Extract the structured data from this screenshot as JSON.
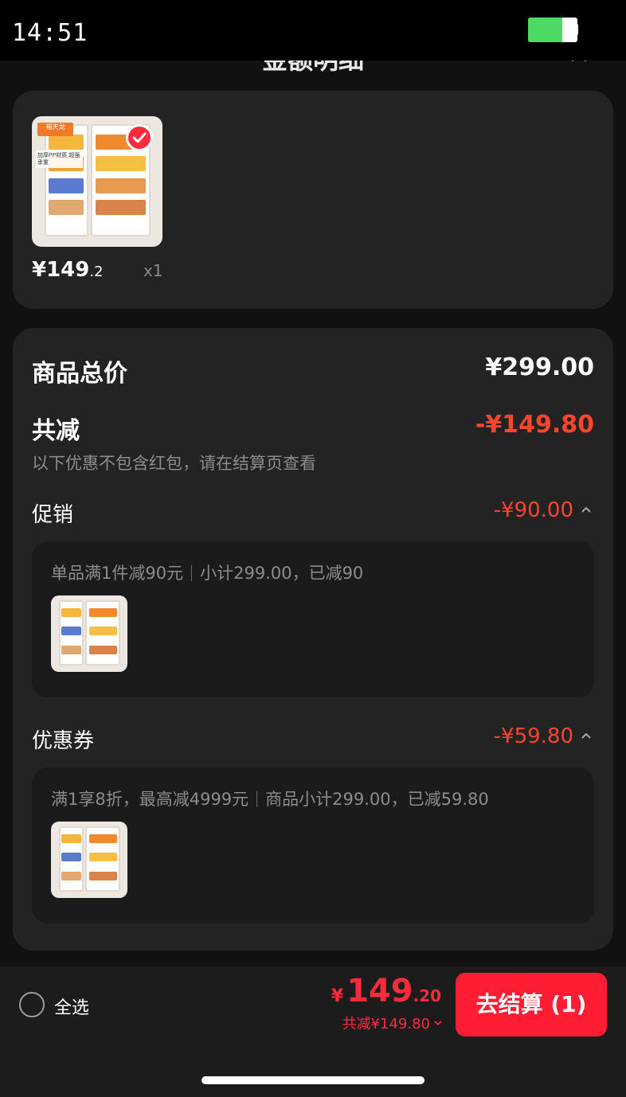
{
  "status_bar": {
    "time": "14:51",
    "battery_level": 0.7
  },
  "sheet": {
    "title": "金额明细",
    "close_icon": "close-icon"
  },
  "product": {
    "price_main": "¥149",
    "price_cents": ".2",
    "quantity": "x1",
    "selected": true,
    "thumbnail_tag": "福天龙",
    "thumbnail_caption": "加厚PP材质 超强承重"
  },
  "summary": {
    "total_label": "商品总价",
    "total_value": "¥299.00",
    "reduce_label": "共减",
    "reduce_value": "-¥149.80",
    "reduce_note": "以下优惠不包含红包，请在结算页查看",
    "promotion": {
      "label": "促销",
      "value": "-¥90.00",
      "desc_left": "单品满1件减90元",
      "desc_right": "小计299.00，已减90"
    },
    "coupon": {
      "label": "优惠券",
      "value": "-¥59.80",
      "desc_left": "满1享8折，最高减4999元",
      "desc_right": "商品小计299.00，已减59.80"
    }
  },
  "bottom_bar": {
    "select_all_label": "全选",
    "price_currency": "¥",
    "price_int": "149",
    "price_dec": ".20",
    "reduce_text": "共减¥149.80",
    "checkout_label": "去结算 (1)"
  },
  "colors": {
    "accent_red": "#ff2a3c",
    "discount_red": "#ff4530",
    "card_bg": "#232323",
    "page_bg": "#111111"
  }
}
